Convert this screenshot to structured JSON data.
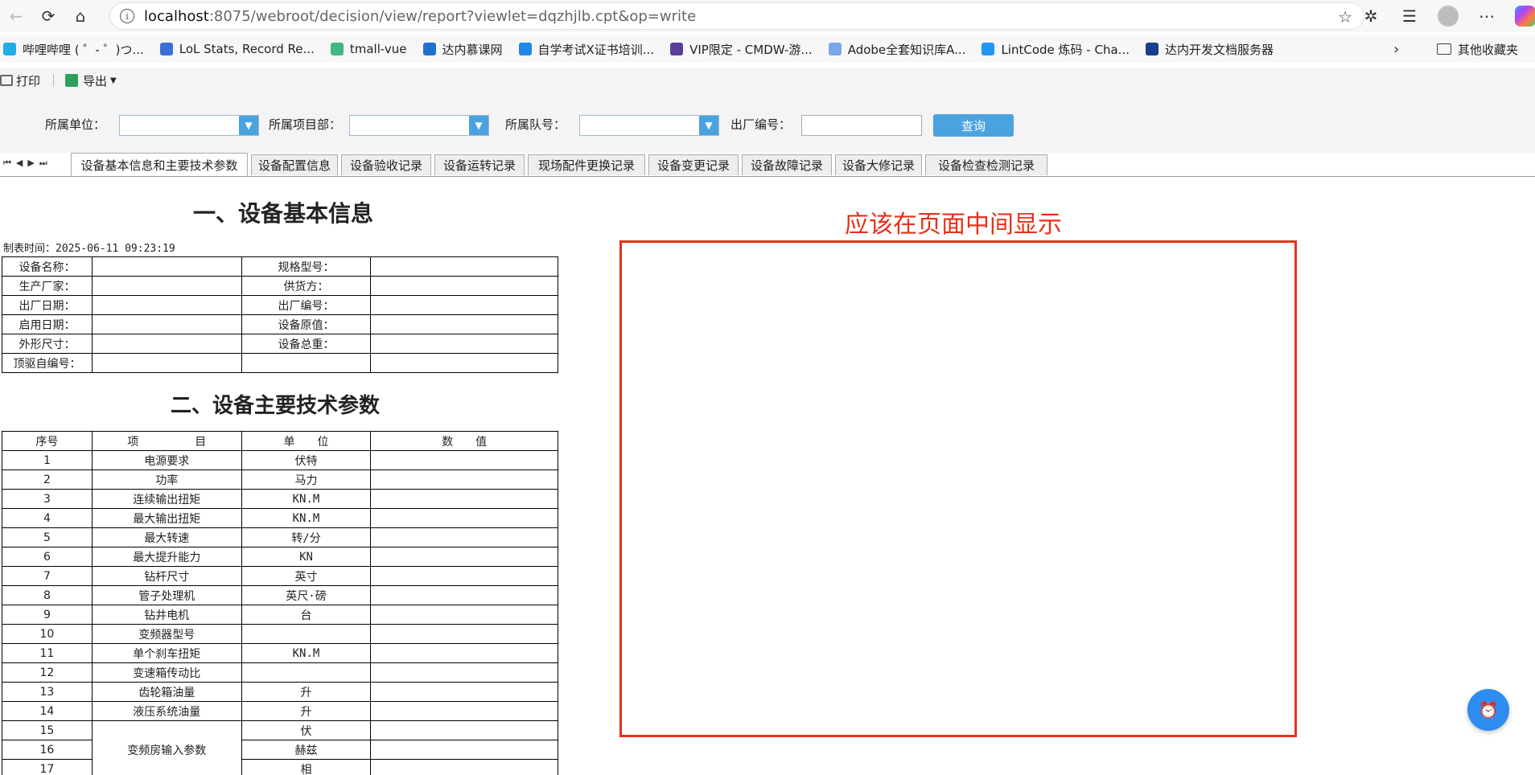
{
  "browser": {
    "url_host": "localhost",
    "url_rest": ":8075/webroot/decision/view/report?viewlet=dqzhjlb.cpt&op=write",
    "bookmarks": [
      {
        "label": "哔哩哔哩 ( ゜- ゜)つ...",
        "color": "#23ade5"
      },
      {
        "label": "LoL Stats, Record Re...",
        "color": "#3b6fd6"
      },
      {
        "label": "tmall-vue",
        "color": "#41b883"
      },
      {
        "label": "达内慕课网",
        "color": "#1f6fd1"
      },
      {
        "label": "自学考试X证书培训...",
        "color": "#1e88e5"
      },
      {
        "label": "VIP限定 - CMDW-游...",
        "color": "#5a3f99"
      },
      {
        "label": "Adobe全套知识库A...",
        "color": "#7aa7e8"
      },
      {
        "label": "LintCode 炼码 - Cha...",
        "color": "#2196f3"
      },
      {
        "label": "达内开发文档服务器",
        "color": "#1a3d8f"
      }
    ],
    "other_bookmarks": "其他收藏夹"
  },
  "toolbar": {
    "print_label": "打印",
    "export_label": "导出"
  },
  "filters": {
    "unit_label": "所属单位：",
    "project_label": "所属项目部：",
    "team_label": "所属队号：",
    "serial_label": "出厂编号：",
    "query_label": "查询"
  },
  "tabs": [
    "设备基本信息和主要技术参数",
    "设备配置信息",
    "设备验收记录",
    "设备运转记录",
    "现场配件更换记录",
    "设备变更记录",
    "设备故障记录",
    "设备大修记录",
    "设备检查检测记录"
  ],
  "report": {
    "title1": "一、设备基本信息",
    "timestamp": "制表时间：2025-06-11 09:23:19",
    "basic_rows": [
      [
        "设备名称：",
        "",
        "规格型号：",
        ""
      ],
      [
        "生产厂家：",
        "",
        "供货方：",
        ""
      ],
      [
        "出厂日期：",
        "",
        "出厂编号：",
        ""
      ],
      [
        "启用日期：",
        "",
        "设备原值：",
        ""
      ],
      [
        "外形尺寸：",
        "",
        "设备总重：",
        ""
      ],
      [
        "顶驱自编号：",
        "",
        "",
        ""
      ]
    ],
    "title2": "二、设备主要技术参数",
    "param_header": [
      "序号",
      "项　　　　　目",
      "单　　位",
      "数　　值"
    ],
    "param_rows": [
      [
        "1",
        "电源要求",
        "伏特",
        ""
      ],
      [
        "2",
        "功率",
        "马力",
        ""
      ],
      [
        "3",
        "连续输出扭矩",
        "KN.M",
        ""
      ],
      [
        "4",
        "最大输出扭矩",
        "KN.M",
        ""
      ],
      [
        "5",
        "最大转速",
        "转/分",
        ""
      ],
      [
        "6",
        "最大提升能力",
        "KN",
        ""
      ],
      [
        "7",
        "钻杆尺寸",
        "英寸",
        ""
      ],
      [
        "8",
        "管子处理机",
        "英尺·磅",
        ""
      ],
      [
        "9",
        "钻井电机",
        "台",
        ""
      ],
      [
        "10",
        "变频器型号",
        "",
        ""
      ],
      [
        "11",
        "单个刹车扭矩",
        "KN.M",
        ""
      ],
      [
        "12",
        "变速箱传动比",
        "",
        ""
      ],
      [
        "13",
        "齿轮箱油量",
        "升",
        ""
      ],
      [
        "14",
        "液压系统油量",
        "升",
        ""
      ]
    ],
    "merged_label": "变频房输入参数",
    "merged_rows": [
      [
        "15",
        "伏",
        ""
      ],
      [
        "16",
        "赫兹",
        ""
      ],
      [
        "17",
        "相",
        ""
      ]
    ]
  },
  "annotation": {
    "text": "应该在页面中间显示",
    "color": "#e8311a"
  }
}
